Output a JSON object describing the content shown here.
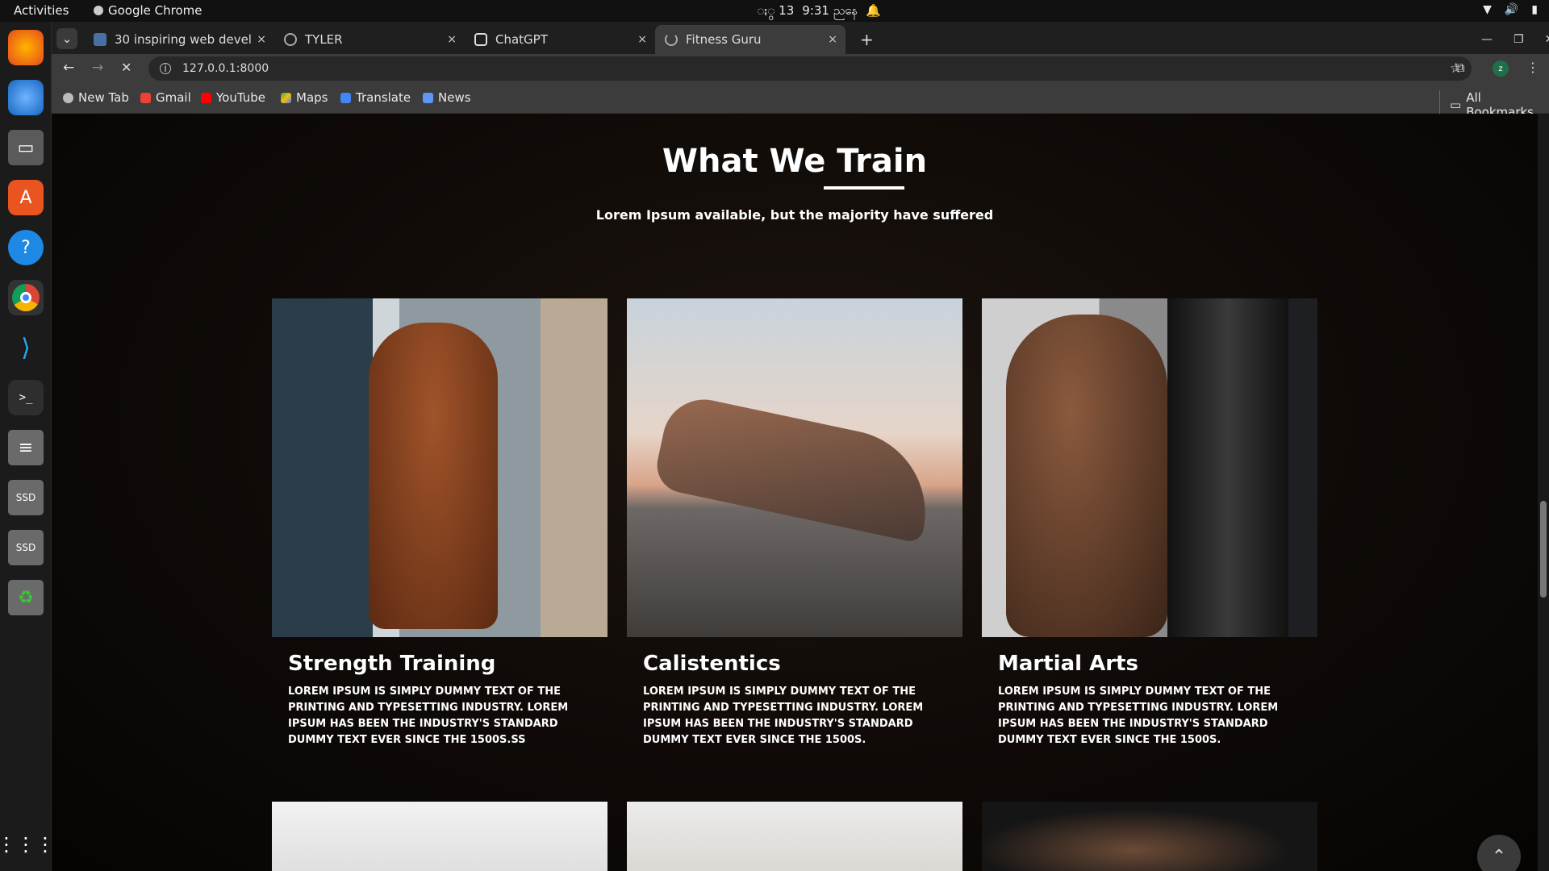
{
  "os": {
    "activities": "Activities",
    "app_name": "Google Chrome",
    "date": "ႏွ 13",
    "time": "9:31 ညနေ"
  },
  "tabs": [
    {
      "title": "30 inspiring web develo",
      "close": "×"
    },
    {
      "title": "TYLER",
      "close": "×"
    },
    {
      "title": "ChatGPT",
      "close": "×"
    },
    {
      "title": "Fitness Guru",
      "close": "×",
      "active": true
    }
  ],
  "new_tab": "+",
  "url": "127.0.0.1:8000",
  "bookmarks": [
    "New Tab",
    "Gmail",
    "YouTube",
    "Maps",
    "Translate",
    "News"
  ],
  "all_bookmarks": "All Bookmarks",
  "section": {
    "title": "What We Train",
    "subtitle": "Lorem Ipsum available, but the majority have suffered",
    "cards": [
      {
        "title": "Strength Training",
        "text": "Lorem Ipsum is simply dummy text of the printing and typesetting industry. Lorem Ipsum has been the industry's standard dummy text ever since the 1500s.ss"
      },
      {
        "title": "Calistentics",
        "text": "Lorem Ipsum is simply dummy text of the printing and typesetting industry. Lorem Ipsum has been the industry's standard dummy text ever since the 1500s."
      },
      {
        "title": "Martial Arts",
        "text": "Lorem Ipsum is simply dummy text of the printing and typesetting industry. Lorem Ipsum has been the industry's standard dummy text ever since the 1500s."
      }
    ]
  },
  "dock_icons": [
    "firefox-icon",
    "thunderbird-icon",
    "files-icon",
    "app-center-icon",
    "help-icon",
    "chrome-icon",
    "vscode-icon",
    "terminal-icon",
    "text-editor-icon",
    "ssd-drive-icon",
    "ssd-drive-icon",
    "trash-icon",
    "app-grid-icon"
  ]
}
